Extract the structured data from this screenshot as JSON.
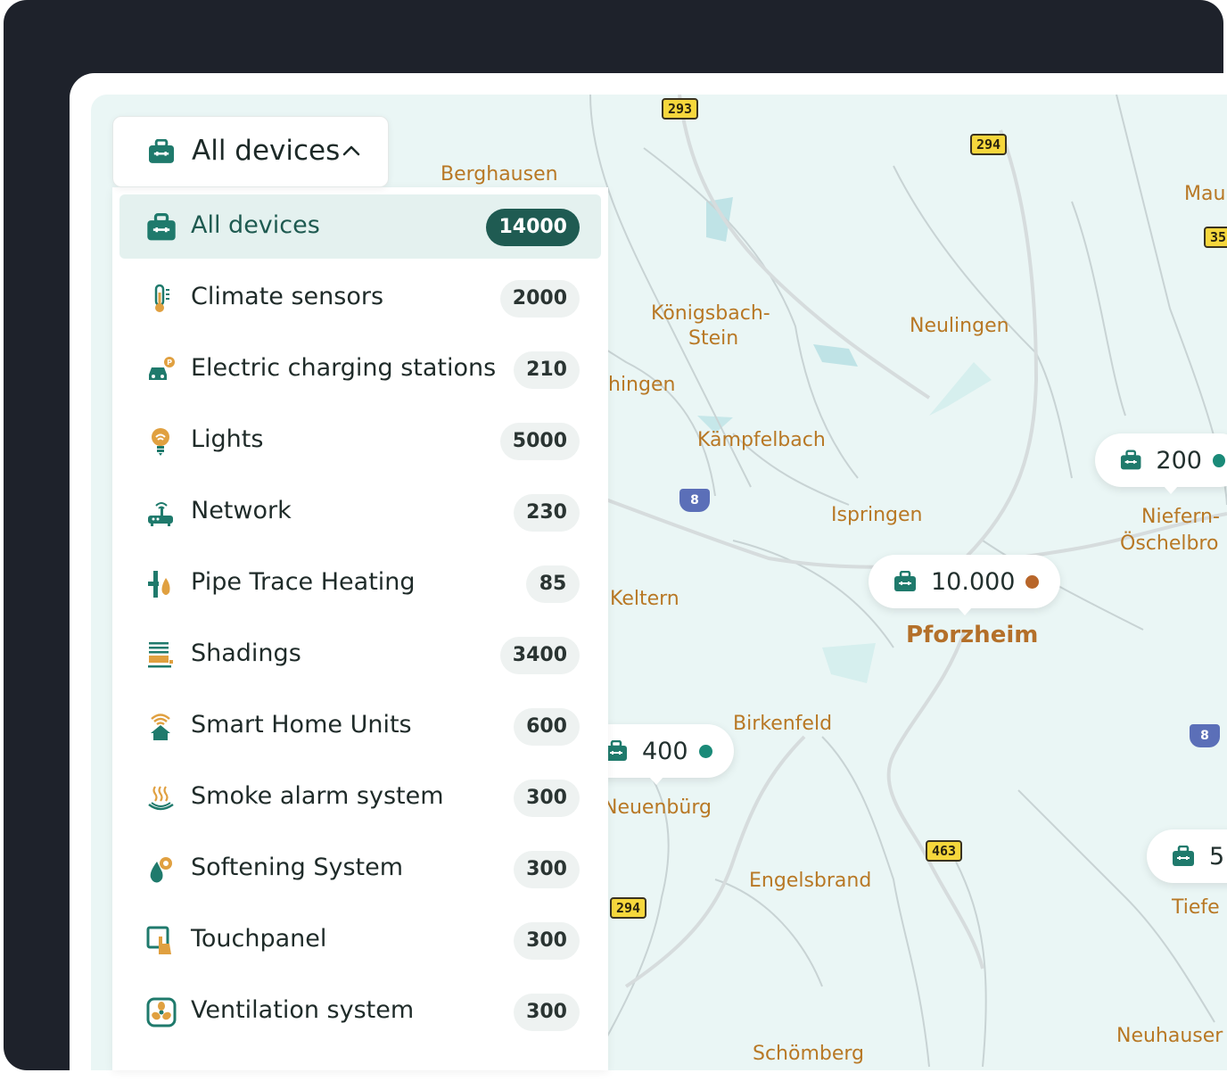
{
  "dropdown": {
    "label": "All devices"
  },
  "device_types": [
    {
      "label": "All devices",
      "count": "14000",
      "icon": "toolbox-icon",
      "selected": true
    },
    {
      "label": "Climate sensors",
      "count": "2000",
      "icon": "thermometer-icon"
    },
    {
      "label": "Electric charging stations",
      "count": "210",
      "icon": "ev-charging-icon"
    },
    {
      "label": "Lights",
      "count": "5000",
      "icon": "lightbulb-icon"
    },
    {
      "label": "Network",
      "count": "230",
      "icon": "router-icon"
    },
    {
      "label": "Pipe Trace Heating",
      "count": "85",
      "icon": "pipe-heating-icon"
    },
    {
      "label": "Shadings",
      "count": "3400",
      "icon": "blinds-icon"
    },
    {
      "label": "Smart Home Units",
      "count": "600",
      "icon": "smart-home-icon"
    },
    {
      "label": "Smoke alarm system",
      "count": "300",
      "icon": "smoke-alarm-icon"
    },
    {
      "label": "Softening System",
      "count": "300",
      "icon": "water-softener-icon"
    },
    {
      "label": "Touchpanel",
      "count": "300",
      "icon": "touchpanel-icon"
    },
    {
      "label": "Ventilation system",
      "count": "300",
      "icon": "fan-icon"
    }
  ],
  "map": {
    "towns": {
      "berghausen": "Berghausen",
      "koenigsbach": "Königsbach-",
      "koenigsbach2": "Stein",
      "neulingen": "Neulingen",
      "hingen": "hingen",
      "kaempfelbach": "Kämpfelbach",
      "ispringen": "Ispringen",
      "niefern": "Niefern-",
      "niefern2": "Öschelbro",
      "keltern": "Keltern",
      "pforzheim": "Pforzheim",
      "birkenfeld": "Birkenfeld",
      "neuenbuerg": "Neuenbürg",
      "engelsbrand": "Engelsbrand",
      "tiefe": "Tiefe",
      "neuhausen": "Neuhauser",
      "schoemberg": "Schömberg",
      "mau": "Mau"
    },
    "roads": {
      "r293": "293",
      "r294a": "294",
      "r294b": "294",
      "r463": "463",
      "r35": "35"
    },
    "highways": {
      "a8a": "8",
      "a8b": "8"
    },
    "markers": [
      {
        "count": "10.000",
        "status_color": "#b8662a"
      },
      {
        "count": "200",
        "status_color": "#1a8a78"
      },
      {
        "count": "400",
        "status_color": "#1a8a78"
      },
      {
        "count": "5",
        "status_color": "#1a8a78"
      }
    ]
  },
  "colors": {
    "accent": "#1f5b52",
    "icon_teal": "#1f7a6c",
    "icon_orange": "#e0a040"
  }
}
